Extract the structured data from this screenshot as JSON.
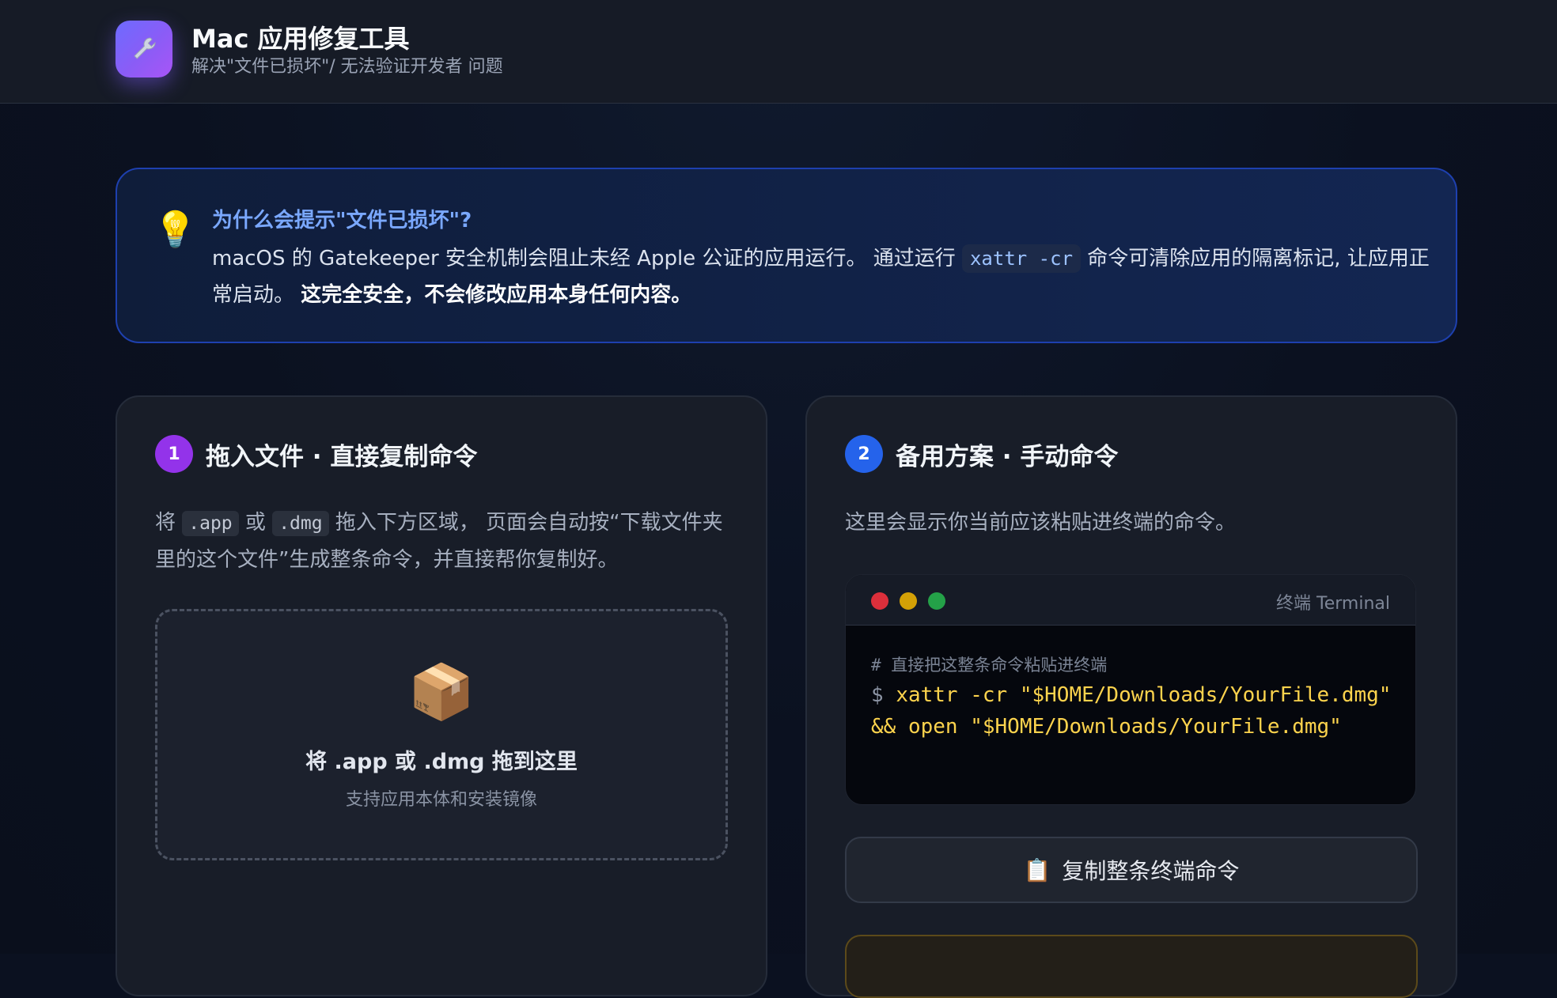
{
  "header": {
    "icon": "wrench-icon",
    "title": "Mac 应用修复工具",
    "subtitle": "解决\"文件已损坏\"/ 无法验证开发者 问题"
  },
  "info": {
    "icon": "lightbulb-icon",
    "title": "为什么会提示\"文件已损坏\"?",
    "body_part1": "macOS 的 Gatekeeper 安全机制会阻止未经 Apple 公证的应用运行。 通过运行 ",
    "code": "xattr -cr",
    "body_part2": " 命令可清除应用的隔离标记, 让应用正常启动。 ",
    "body_strong": "这完全安全，不会修改应用本身任何内容。"
  },
  "step1": {
    "number": "1",
    "title": "拖入文件 · 直接复制命令",
    "desc_part1": "将 ",
    "chip_app": ".app",
    "desc_or": " 或 ",
    "chip_dmg": ".dmg",
    "desc_part2": " 拖入下方区域， 页面会自动按“下载文件夹里的这个文件”生成整条命令，并直接帮你复制好。",
    "dropzone": {
      "icon": "package-icon",
      "title": "将 .app 或 .dmg 拖到这里",
      "hint": "支持应用本体和安装镜像"
    }
  },
  "step2": {
    "number": "2",
    "title": "备用方案 · 手动命令",
    "desc": "这里会显示你当前应该粘贴进终端的命令。",
    "terminal": {
      "label": "终端 Terminal",
      "comment": "# 直接把这整条命令粘贴进终端",
      "prompt": "$ ",
      "command": "xattr -cr \"$HOME/Downloads/YourFile.dmg\" && open \"$HOME/Downloads/YourFile.dmg\""
    },
    "copy_icon": "clipboard-icon",
    "copy_label": "复制整条终端命令"
  },
  "colors": {
    "accent_purple": "#9333ea",
    "accent_blue": "#2563eb",
    "command_yellow": "#fcd34d",
    "info_title_blue": "#7aa8ff"
  }
}
